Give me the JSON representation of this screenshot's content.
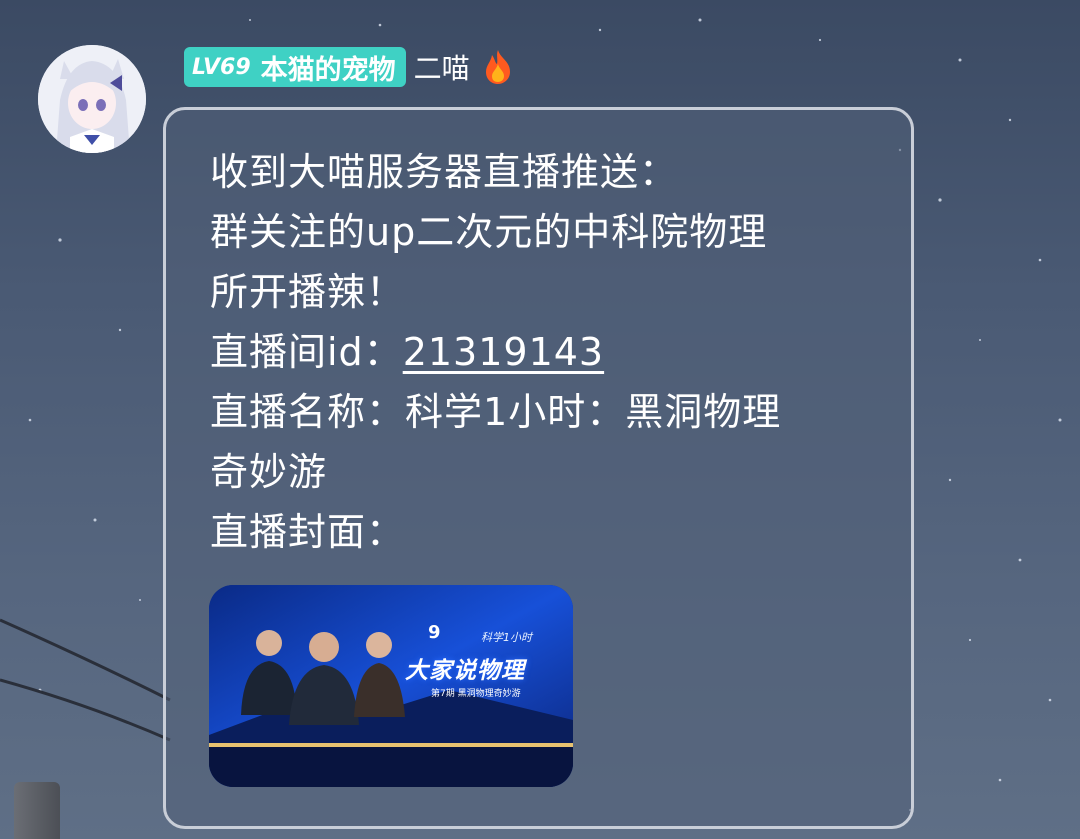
{
  "user": {
    "level": "LV69",
    "title": "本猫的宠物",
    "name": "二喵"
  },
  "message": {
    "lines": [
      "收到大喵服务器直播推送：",
      "群关注的up二次元的中科院物理",
      "所开播辣！"
    ],
    "room_id_label": "直播间id：",
    "room_id": "21319143",
    "room_name_label": "直播名称：",
    "room_name_line1": "科学1小时：黑洞物理",
    "room_name_line2": "奇妙游",
    "cover_label": "直播封面："
  },
  "cover": {
    "title": "大家说物理",
    "subtitle": "第7期 黑洞物理奇妙游",
    "logo_number": "9",
    "logo_text": "科学1小时"
  },
  "colors": {
    "badge": "#3fd1c4",
    "bubble_border": "#c9ced8",
    "cover_blue": "#0b2d8a"
  },
  "icons": {
    "fire": "fire-icon",
    "avatar": "anime-girl-avatar"
  }
}
